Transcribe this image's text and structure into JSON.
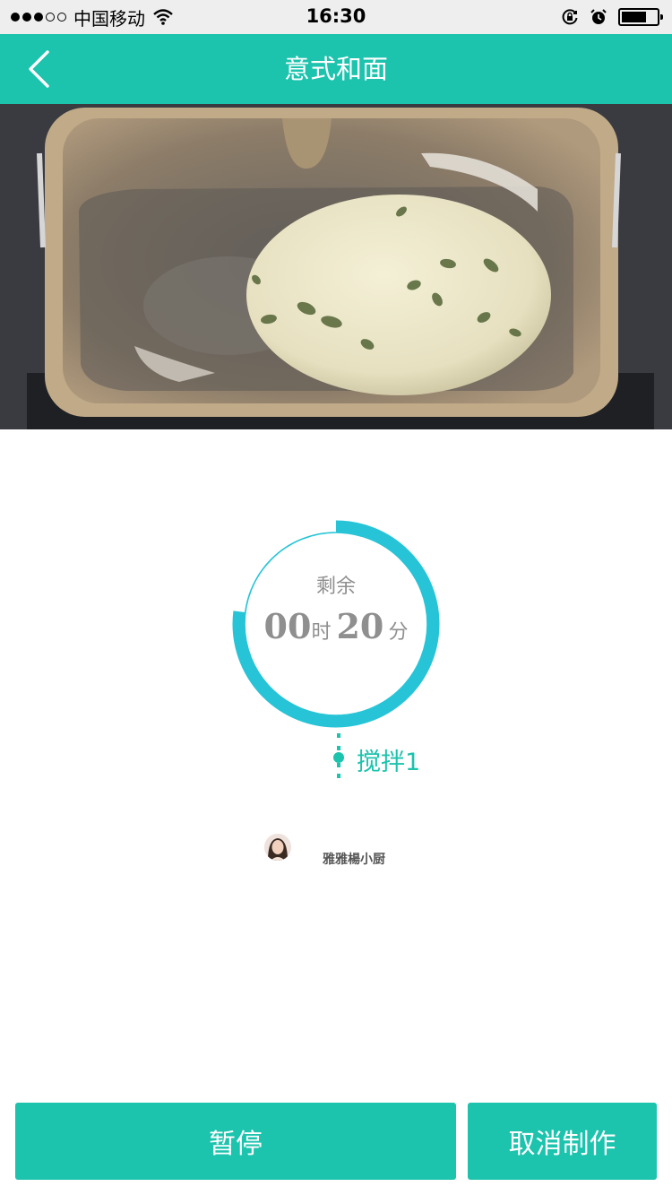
{
  "status_bar": {
    "carrier": "中国移动",
    "time": "16:30",
    "signal_bars_filled": 3,
    "signal_bars_total": 5,
    "battery_level": 0.7,
    "icons": [
      "wifi-icon",
      "orientation-lock-icon",
      "alarm-icon",
      "battery-icon"
    ]
  },
  "nav": {
    "title": "意式和面",
    "back_icon": "chevron-left-icon"
  },
  "photo": {
    "subject": "bread dough with pumpkin seeds in bread machine pan"
  },
  "timer": {
    "label": "剩余",
    "hours": "00",
    "hours_unit": "时",
    "minutes": "20",
    "minutes_unit": "分",
    "progress": 0.77
  },
  "step": {
    "name": "搅拌1"
  },
  "author": {
    "name": "雅雅楊小厨"
  },
  "actions": {
    "pause": "暂停",
    "cancel": "取消制作"
  },
  "colors": {
    "accent": "#1cc3ad",
    "ring": "#26c4d6",
    "text_gray": "#8f8f8f"
  }
}
